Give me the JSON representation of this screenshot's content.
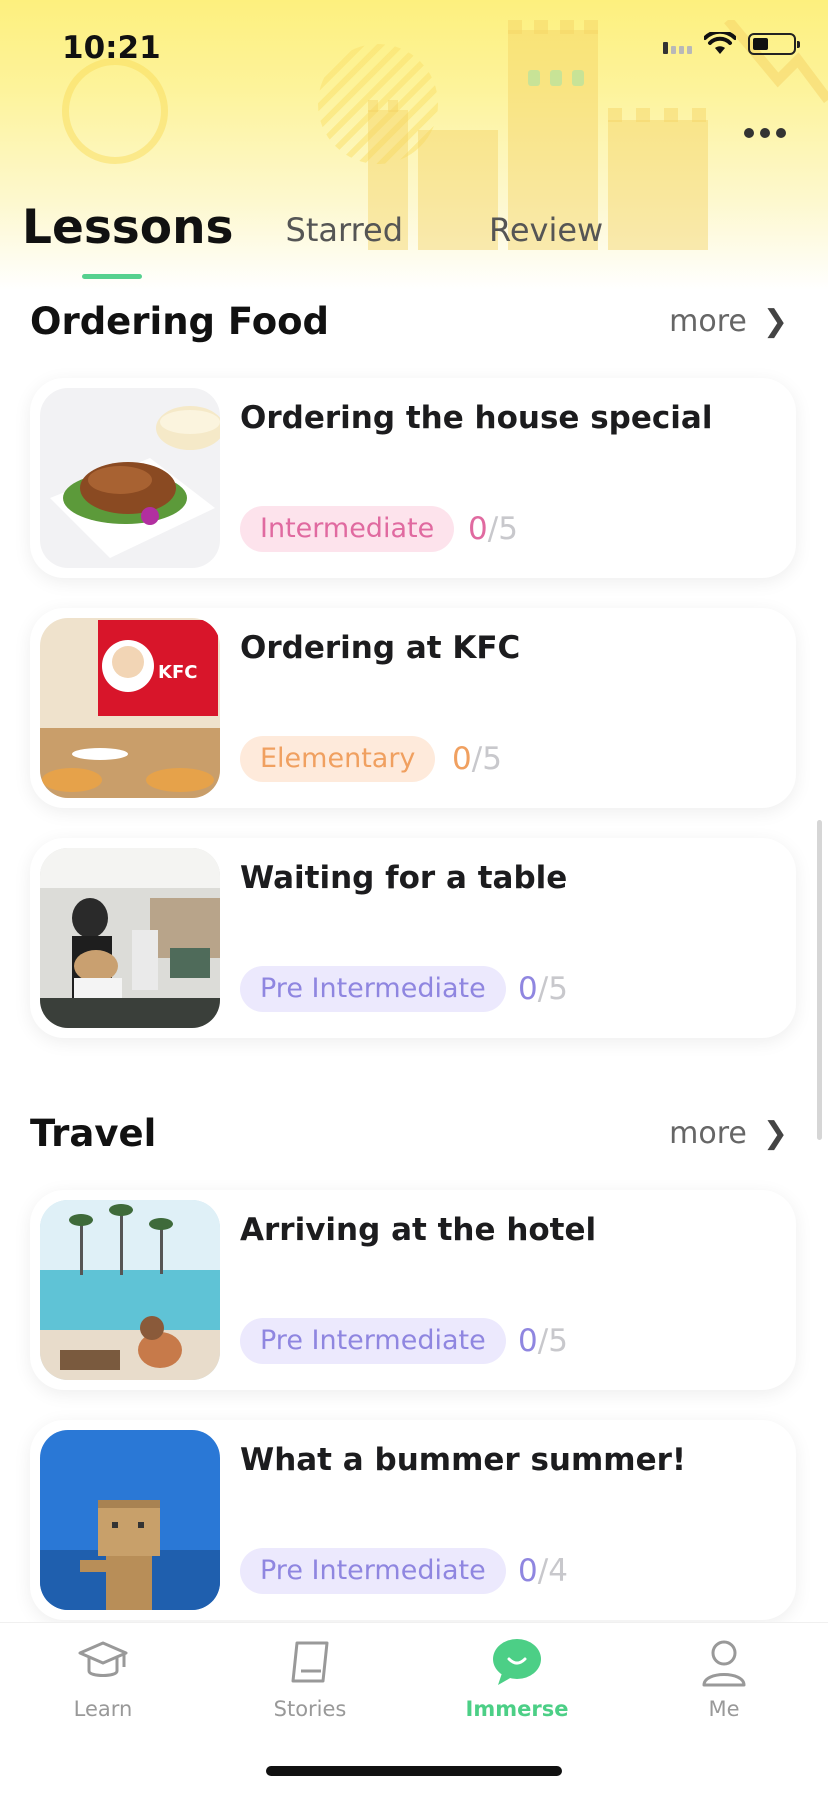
{
  "status_bar": {
    "time": "10:21",
    "battery_level": 0.4
  },
  "header": {
    "tabs": [
      {
        "label": "Lessons",
        "active": true
      },
      {
        "label": "Starred",
        "active": false
      },
      {
        "label": "Review",
        "active": false
      }
    ]
  },
  "sections": [
    {
      "title": "Ordering Food",
      "more_label": "more",
      "lessons": [
        {
          "title": "Ordering the house special",
          "level": "Intermediate",
          "done": "0",
          "sep": "/",
          "total": "5",
          "level_color": "#e06aa0",
          "level_bg": "#fde3ec",
          "image": "roast-duck-photo"
        },
        {
          "title": "Ordering at KFC",
          "level": "Elementary",
          "done": "0",
          "sep": "/",
          "total": "5",
          "level_color": "#f0a060",
          "level_bg": "#feeadb",
          "image": "kfc-restaurant-photo"
        },
        {
          "title": "Waiting for a table",
          "level": "Pre Intermediate",
          "done": "0",
          "sep": "/",
          "total": "5",
          "level_color": "#8f86e0",
          "level_bg": "#ece9fd",
          "image": "busy-restaurant-photo"
        }
      ]
    },
    {
      "title": "Travel",
      "more_label": "more",
      "lessons": [
        {
          "title": "Arriving at the hotel",
          "level": "Pre Intermediate",
          "done": "0",
          "sep": "/",
          "total": "5",
          "level_color": "#8f86e0",
          "level_bg": "#ece9fd",
          "image": "hotel-pool-photo"
        },
        {
          "title": "What a bummer summer!",
          "level": "Pre Intermediate",
          "done": "0",
          "sep": "/",
          "total": "4",
          "level_color": "#8f86e0",
          "level_bg": "#ece9fd",
          "image": "cardboard-robot-photo"
        }
      ]
    }
  ],
  "tabbar": {
    "items": [
      {
        "label": "Learn",
        "icon": "graduation-cap-icon",
        "active": false
      },
      {
        "label": "Stories",
        "icon": "book-icon",
        "active": false
      },
      {
        "label": "Immerse",
        "icon": "chat-bubble-icon",
        "active": true
      },
      {
        "label": "Me",
        "icon": "person-icon",
        "active": false
      }
    ],
    "active_color": "#4ccf86",
    "inactive_color": "#999999"
  },
  "accent_color": "#56d18f"
}
